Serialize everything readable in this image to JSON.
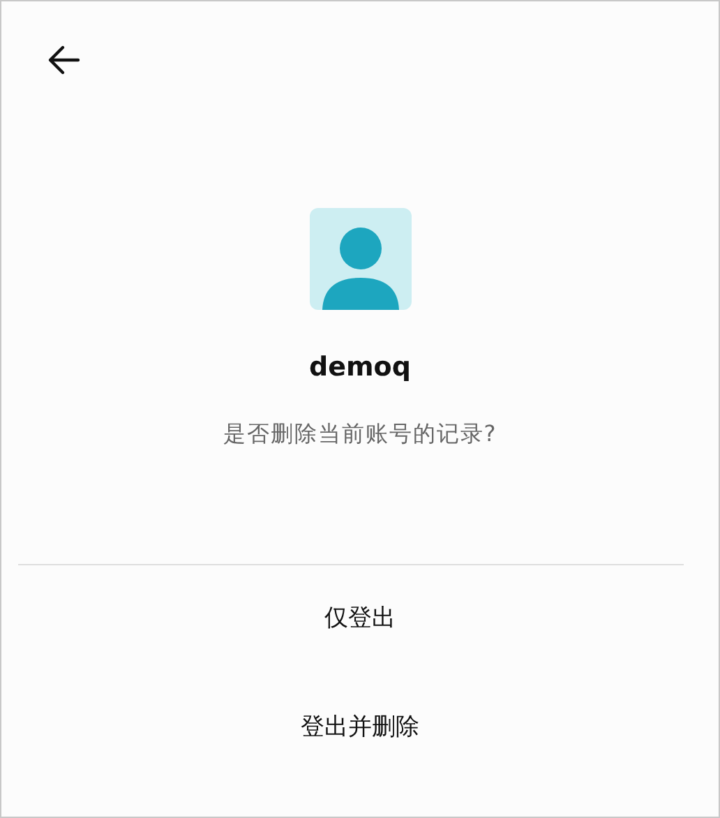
{
  "account": {
    "username": "demoq",
    "prompt": "是否删除当前账号的记录?"
  },
  "actions": [
    {
      "label": "仅登出"
    },
    {
      "label": "登出并删除"
    }
  ]
}
